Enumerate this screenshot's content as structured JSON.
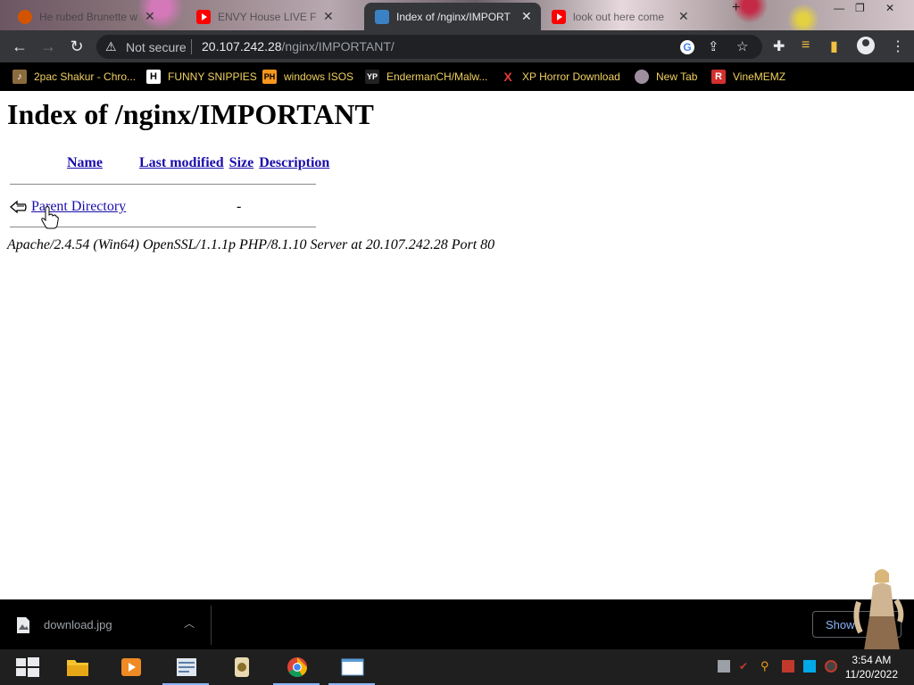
{
  "browser": {
    "tabs": [
      {
        "title": "He rubed Brunette with",
        "favicon": "fire-icon",
        "active": false
      },
      {
        "title": "ENVY House LIVE Fo",
        "favicon": "youtube-icon",
        "active": false
      },
      {
        "title": "Index of /nginx/IMPORT",
        "favicon": "document-icon",
        "active": true
      },
      {
        "title": "look out here come",
        "favicon": "youtube-icon",
        "active": false
      }
    ],
    "address": {
      "security_label": "Not secure",
      "host": "20.107.242.28",
      "path": "/nginx/IMPORTANT/"
    },
    "bookmarks": [
      {
        "label": "2pac Shakur - Chro...",
        "icon": "music-icon"
      },
      {
        "label": "FUNNY SNIPPIES",
        "icon": "h-icon"
      },
      {
        "label": "windows ISOS",
        "icon": "ph-icon"
      },
      {
        "label": "EndermanCH/Malw...",
        "icon": "yp-icon"
      },
      {
        "label": "XP Horror Download",
        "icon": "x-icon"
      },
      {
        "label": "New Tab",
        "icon": "globe-icon"
      },
      {
        "label": "VineMEMZ",
        "icon": "r-icon"
      }
    ]
  },
  "page": {
    "title": "Index of /nginx/IMPORTANT",
    "columns": [
      "Name",
      "Last modified",
      "Size",
      "Description"
    ],
    "rows": [
      {
        "name": "Parent Directory",
        "modified": "",
        "size": "-",
        "description": ""
      }
    ],
    "server_signature": "Apache/2.4.54 (Win64) OpenSSL/1.1.1p PHP/8.1.10 Server at 20.107.242.28 Port 80"
  },
  "downloads": {
    "file_name": "download.jpg",
    "show_all_label": "Show"
  },
  "taskbar": {
    "time": "3:54 AM",
    "date": "11/20/2022"
  },
  "colors": {
    "link": "#1a0dab",
    "bookmark_text": "#f0d060",
    "toolbar_bg": "#35363a"
  }
}
